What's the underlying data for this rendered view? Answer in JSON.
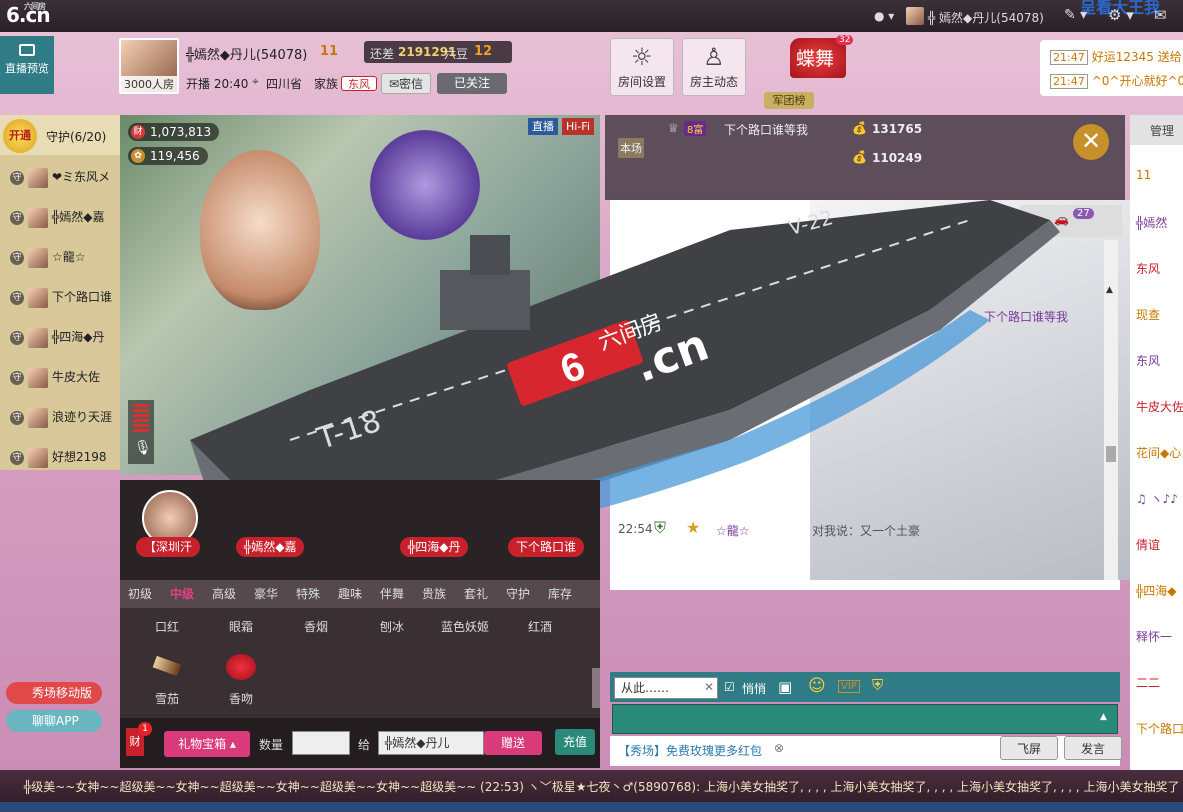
{
  "topbar": {
    "logo": "6.cn",
    "logo_small": "六间房",
    "user_name": "╬ 嫣然◆丹儿(54078)",
    "header_marquee": "呈看大王我"
  },
  "left_nav": {
    "preview_label": "直播预览"
  },
  "host": {
    "room_capacity": "3000人房",
    "name": "╬嫣然◆丹儿(54078)",
    "level": "11",
    "gap_label": "还差",
    "gap_value": "2191291",
    "gap_unit": "六豆",
    "next_level": "12",
    "start_label": "开播 20:40",
    "location": "四川省",
    "family_label": "家族",
    "family_name": "东风",
    "message_button": "密信",
    "follow_button": "已关注"
  },
  "room_buttons": {
    "settings": "房间设置",
    "dynamics": "房主动态"
  },
  "dance_badge": {
    "label": "蝶舞",
    "count": "32",
    "sub": "军团榜"
  },
  "chat_preview": [
    {
      "time": "21:47",
      "text": "好运12345 送给"
    },
    {
      "time": "21:47",
      "text": "^0^开心就好^0^"
    }
  ],
  "guards": {
    "open_button": "开通",
    "header": "守护(6/20)",
    "shield": "守",
    "items": [
      {
        "name": "❤ミ东风メ"
      },
      {
        "name": "╬嫣然◆嘉"
      },
      {
        "name": "☆龍☆"
      },
      {
        "name": "下个路口谁"
      },
      {
        "name": "╬四海◆丹"
      },
      {
        "name": "牛皮大佐"
      },
      {
        "name": "浪迹り天涯"
      },
      {
        "name": "好想2198"
      }
    ]
  },
  "video": {
    "wealth": "1,073,813",
    "fans": "119,456",
    "live_tag": "直播",
    "hifi_tag": "Hi-Fi",
    "ship_text_brand": "六间房",
    "ship_text_domain": ".cn",
    "ship_hull": "T-18",
    "ship_code": "V-22"
  },
  "gift_avatars": [
    {
      "name": "【深圳汗"
    },
    {
      "name": "╬嫣然◆嘉"
    },
    {
      "name": "╬四海◆丹"
    },
    {
      "name": "下个路口谁"
    }
  ],
  "gift_tabs": [
    "初级",
    "中级",
    "高级",
    "豪华",
    "特殊",
    "趣味",
    "伴舞",
    "贵族",
    "套礼",
    "守护",
    "库存"
  ],
  "gifts_row1": [
    "口红",
    "眼霜",
    "香烟",
    "刨冰",
    "蓝色妖姬",
    "红酒"
  ],
  "gifts_row2": [
    "雪茄",
    "香吻"
  ],
  "side_apps": {
    "mobile": "秀场移动版",
    "chat_app": "聊聊APP"
  },
  "send_bar": {
    "wealth_label": "财",
    "wealth_badge": "1",
    "gift_box": "礼物宝箱",
    "qty_label": "数量",
    "to_label": "给",
    "recipient": "╬嫣然◆丹儿",
    "send_button": "赠送",
    "recharge_button": "充值"
  },
  "rank_panel": {
    "row1_tag": "8富",
    "row1_text": "下个路口谁等我",
    "row1_value": "131765",
    "row2_value": "110249",
    "row_side": "本场",
    "chat_count": "27"
  },
  "chat": {
    "line1_text": "下个路口谁等我",
    "line2_time": "22:54",
    "line2_user": "☆龍☆",
    "line2_text": "对我说：又一个土豪",
    "filter_value": "从此……",
    "quiet_label": "悄悄",
    "input_placeholder": "",
    "promo": "【秀场】免费玫瑰更多红包",
    "fly_button": "飞屏",
    "send_button": "发言"
  },
  "right_col": {
    "header": "管理",
    "entries": [
      "11",
      "╬嫣然",
      "东风",
      "现查",
      "东风",
      "牛皮大佐",
      "花间◆心",
      "♫ ヽ♪♪",
      "倩谊",
      "╬四海◆",
      "释怀一",
      "二二",
      "下个路口"
    ]
  },
  "bottom_marquee": "╬级美~~女神~~超级美~~女神~~超级美~~女神~~超级美~~女神~~超级美~~  (22:53)   ヽ﹀极星★七夜丶♂(5890768): 上海小美女抽奖了,  ,  ,  ,  上海小美女抽奖了,  ,  ,  ,  上海小美女抽奖了,  ,  ,  ,  上海小美女抽奖了"
}
